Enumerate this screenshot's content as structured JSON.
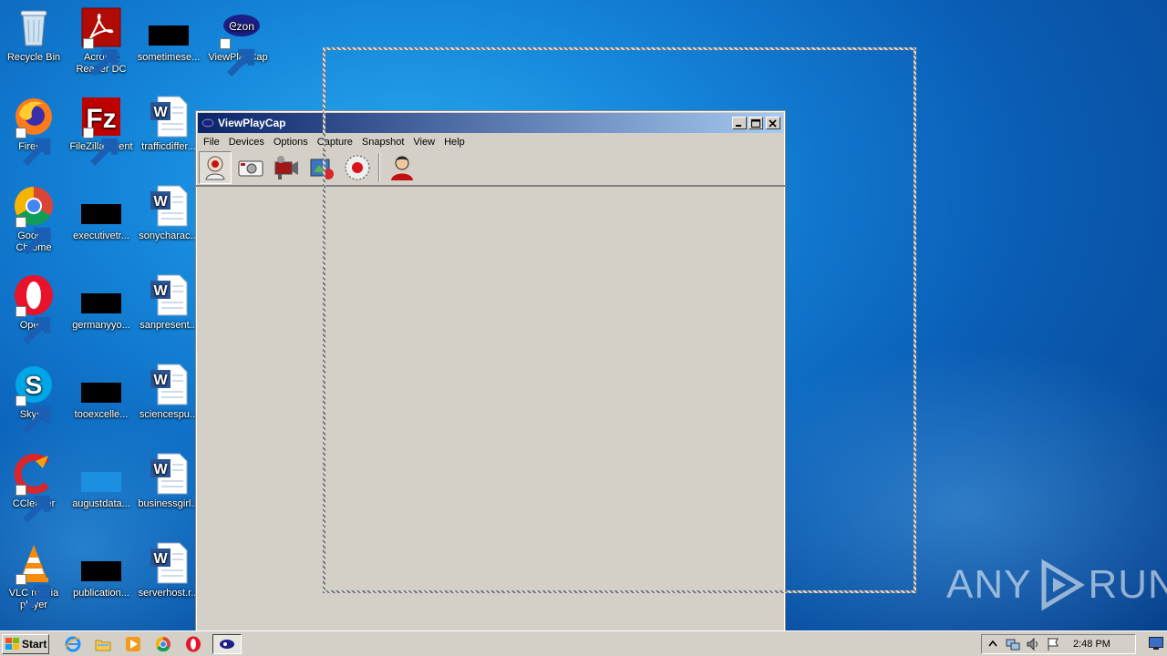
{
  "desktop": {
    "icons": [
      {
        "label": "Recycle Bin",
        "icon": "recycle-bin-icon"
      },
      {
        "label": "Acrobat Reader DC",
        "icon": "acrobat-icon"
      },
      {
        "label": "sometimese...",
        "icon": "redacted-file-icon"
      },
      {
        "label": "ViewPlayCap",
        "icon": "viewplaycap-icon"
      },
      {
        "label": "Firefox",
        "icon": "firefox-icon"
      },
      {
        "label": "FileZilla Client",
        "icon": "filezilla-icon"
      },
      {
        "label": "trafficdiffer...",
        "icon": "word-doc-icon"
      },
      {
        "label": "Google Chrome",
        "icon": "chrome-icon"
      },
      {
        "label": "executivetr...",
        "icon": "redacted-file-icon"
      },
      {
        "label": "sonycharac...",
        "icon": "word-doc-icon"
      },
      {
        "label": "Opera",
        "icon": "opera-icon"
      },
      {
        "label": "germanyyo...",
        "icon": "redacted-file-icon"
      },
      {
        "label": "sanpresent...",
        "icon": "word-doc-icon"
      },
      {
        "label": "Skype",
        "icon": "skype-icon"
      },
      {
        "label": "tooexcelle...",
        "icon": "redacted-file-icon"
      },
      {
        "label": "sciencespu...",
        "icon": "word-doc-icon"
      },
      {
        "label": "CCleaner",
        "icon": "ccleaner-icon"
      },
      {
        "label": "augustdata...",
        "icon": "redacted-file-icon"
      },
      {
        "label": "businessgirl...",
        "icon": "word-doc-icon"
      },
      {
        "label": "VLC media player",
        "icon": "vlc-icon"
      },
      {
        "label": "publication...",
        "icon": "redacted-file-icon"
      },
      {
        "label": "serverhost.r...",
        "icon": "word-doc-icon"
      }
    ]
  },
  "window": {
    "title": "ViewPlayCap",
    "menu": [
      "File",
      "Devices",
      "Options",
      "Capture",
      "Snapshot",
      "View",
      "Help"
    ],
    "toolbar": [
      {
        "icon": "webcam-preview-icon",
        "pressed": true
      },
      {
        "icon": "snapshot-camera-icon",
        "pressed": false
      },
      {
        "icon": "video-camera-icon",
        "pressed": false
      },
      {
        "icon": "capture-settings-icon",
        "pressed": false
      },
      {
        "icon": "record-icon",
        "pressed": false
      },
      {
        "icon": "user-icon",
        "pressed": false
      }
    ]
  },
  "watermark": {
    "left": "ANY",
    "right": "RUN"
  },
  "taskbar": {
    "start_label": "Start",
    "quick_launch": [
      "internet-explorer-icon",
      "explorer-folder-icon",
      "media-player-icon",
      "chrome-icon",
      "opera-icon",
      "viewplaycap-task-icon"
    ],
    "tray_icons": [
      "show-hidden-icons-arrow",
      "network-icon",
      "volume-icon",
      "action-center-flag-icon"
    ],
    "clock": "2:48 PM"
  }
}
